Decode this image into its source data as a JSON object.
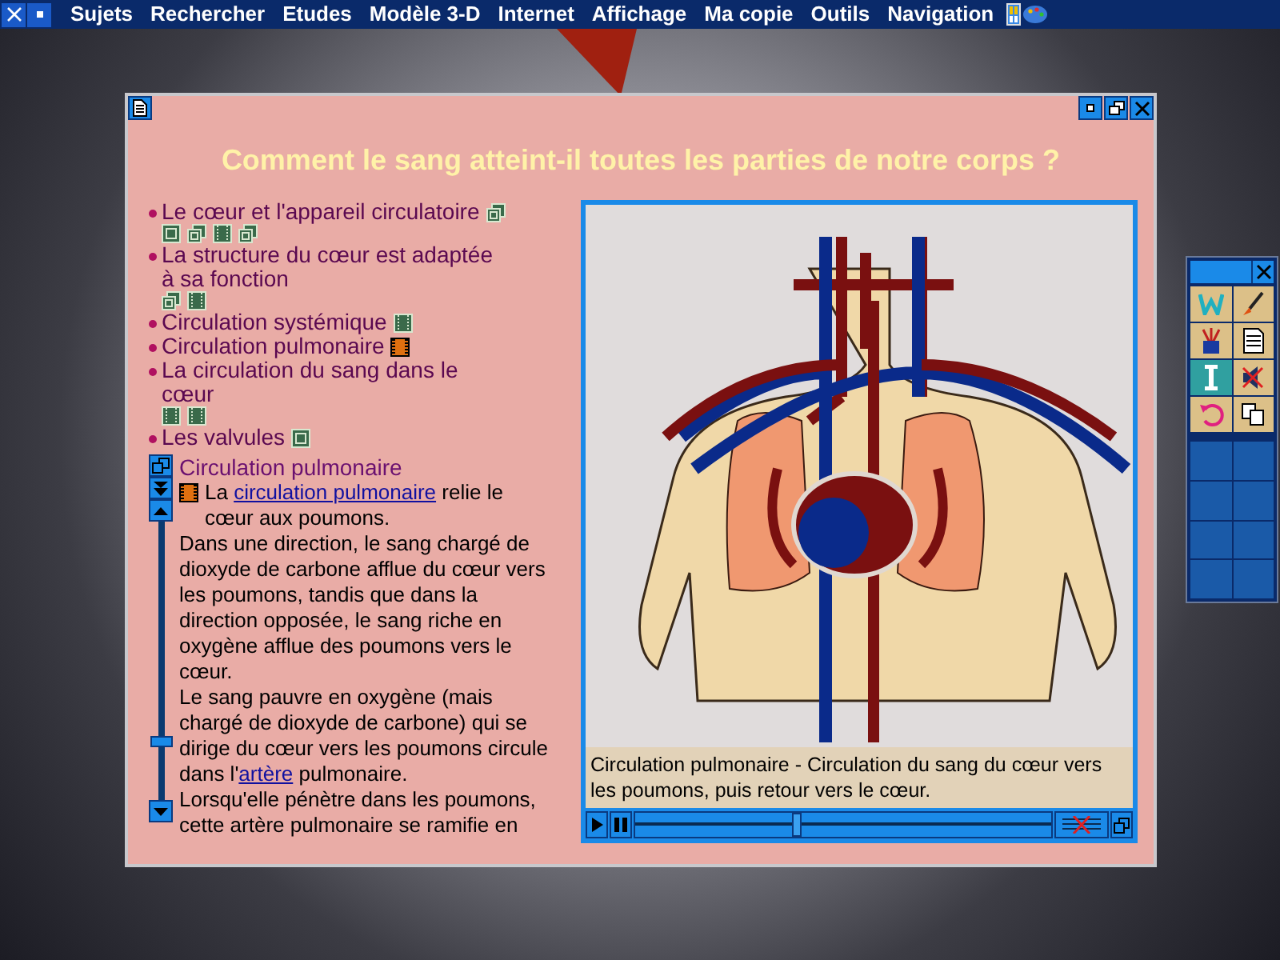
{
  "menu_bar": {
    "items": [
      "Sujets",
      "Rechercher",
      "Etudes",
      "Modèle 3-D",
      "Internet",
      "Affichage",
      "Ma copie",
      "Outils",
      "Navigation"
    ]
  },
  "window": {
    "title": "Comment le sang atteint-il toutes les parties de notre corps ?"
  },
  "topics": [
    {
      "label": "Le cœur et l'appareil circulatoire",
      "media": [
        {
          "kind": "stack"
        },
        {
          "kind": "page"
        },
        {
          "kind": "stack"
        },
        {
          "kind": "film"
        },
        {
          "kind": "stack"
        }
      ]
    },
    {
      "label": "La structure du cœur est adaptée à sa fonction",
      "media": [
        {
          "kind": "stack"
        },
        {
          "kind": "film"
        }
      ]
    },
    {
      "label": "Circulation systémique",
      "media": [
        {
          "kind": "film"
        }
      ]
    },
    {
      "label": "Circulation pulmonaire",
      "media": [
        {
          "kind": "film-active"
        }
      ]
    },
    {
      "label": "La circulation du sang dans le cœur",
      "media": [
        {
          "kind": "film"
        },
        {
          "kind": "film"
        }
      ]
    },
    {
      "label": "Les valvules",
      "media": [
        {
          "kind": "page"
        }
      ]
    }
  ],
  "article": {
    "heading": "Circulation pulmonaire",
    "paragraphs": [
      {
        "media": {
          "kind": "film-active"
        },
        "parts": [
          {
            "text": "La "
          },
          {
            "text": "circulation pulmonaire",
            "link": true
          },
          {
            "text": " relie le cœur aux poumons."
          }
        ]
      },
      {
        "parts": [
          {
            "text": "Dans une direction, le sang chargé de dioxyde de carbone afflue du cœur vers les poumons, tandis que dans la direction opposée, le sang riche en oxygène afflue des poumons vers le cœur."
          }
        ]
      },
      {
        "parts": [
          {
            "text": "Le sang pauvre en oxygène (mais chargé de dioxyde de carbone) qui se dirige du cœur vers les poumons circule dans l'"
          },
          {
            "text": "artère",
            "link": true
          },
          {
            "text": " pulmonaire."
          }
        ]
      },
      {
        "parts": [
          {
            "text": "Lorsqu'elle pénètre dans les poumons, cette artère pulmonaire se ramifie en"
          }
        ]
      }
    ]
  },
  "figure": {
    "caption": "Circulation pulmonaire - Circulation du sang du cœur vers les poumons, puis retour vers le cœur.",
    "level": 0.39
  }
}
